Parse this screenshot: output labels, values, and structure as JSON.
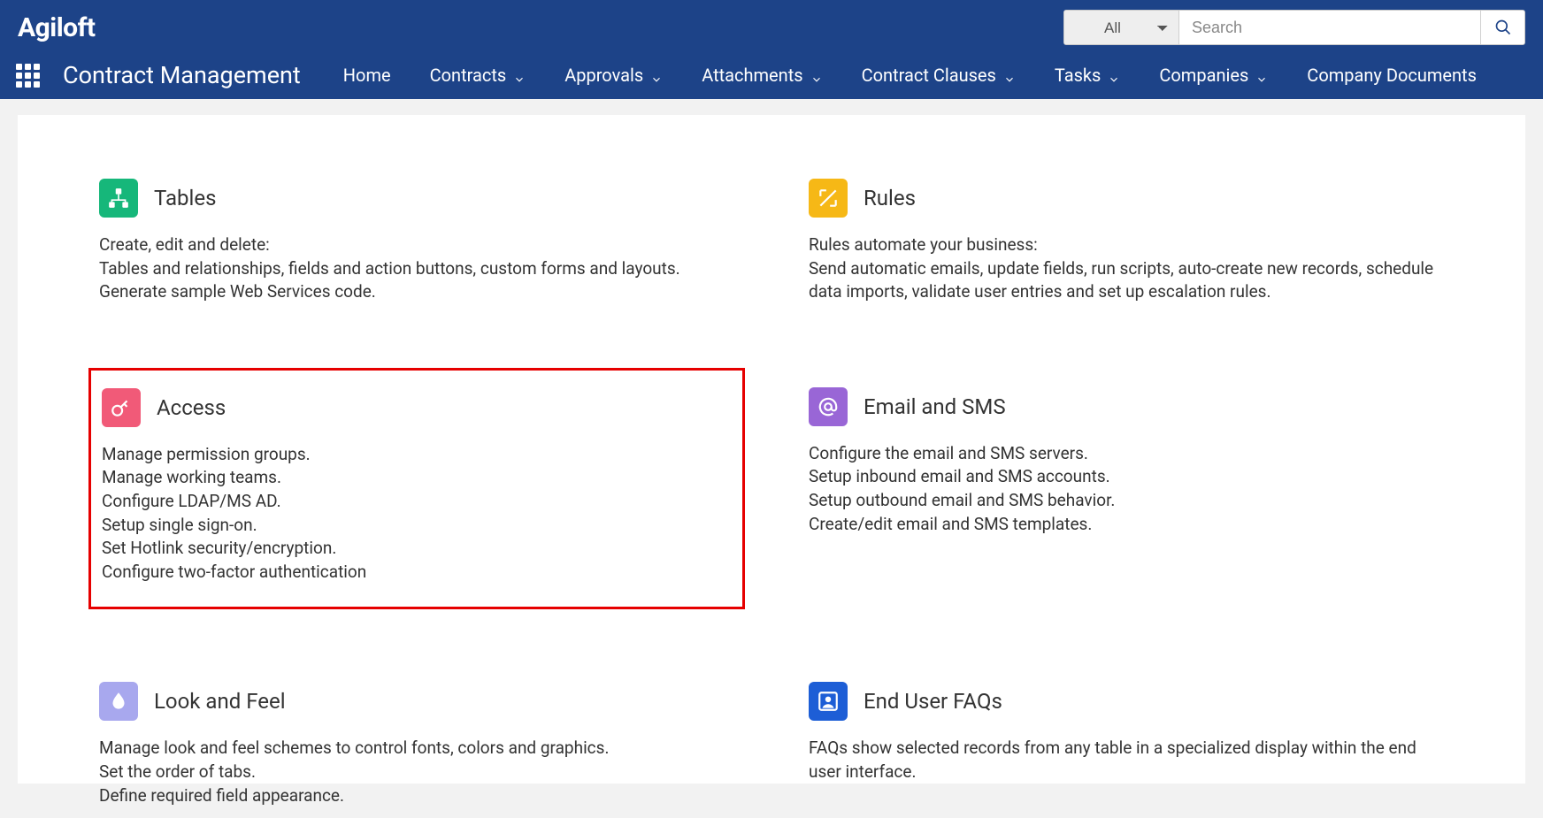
{
  "brand": "Agiloft",
  "search": {
    "filter": "All",
    "placeholder": "Search"
  },
  "app_title": "Contract Management",
  "nav": [
    {
      "label": "Home",
      "has_dropdown": false
    },
    {
      "label": "Contracts",
      "has_dropdown": true
    },
    {
      "label": "Approvals",
      "has_dropdown": true
    },
    {
      "label": "Attachments",
      "has_dropdown": true
    },
    {
      "label": "Contract Clauses",
      "has_dropdown": true
    },
    {
      "label": "Tasks",
      "has_dropdown": true
    },
    {
      "label": "Companies",
      "has_dropdown": true
    },
    {
      "label": "Company Documents",
      "has_dropdown": true
    }
  ],
  "tiles": {
    "tables": {
      "title": "Tables",
      "desc": "Create, edit and delete:\nTables and relationships, fields and action buttons, custom forms and layouts.\nGenerate sample Web Services code."
    },
    "rules": {
      "title": "Rules",
      "desc": "Rules automate your business:\nSend automatic emails, update fields, run scripts, auto-create new records, schedule data imports, validate user entries and set up escalation rules."
    },
    "access": {
      "title": "Access",
      "desc": "Manage permission groups.\nManage working teams.\nConfigure LDAP/MS AD.\nSetup single sign-on.\nSet Hotlink security/encryption.\nConfigure two-factor authentication"
    },
    "email": {
      "title": "Email and SMS",
      "desc": "Configure the email and SMS servers.\nSetup inbound email and SMS accounts.\nSetup outbound email and SMS behavior.\nCreate/edit email and SMS templates."
    },
    "look": {
      "title": "Look and Feel",
      "desc": "Manage look and feel schemes to control fonts, colors and graphics.\nSet the order of tabs.\nDefine required field appearance."
    },
    "faq": {
      "title": "End User FAQs",
      "desc": "FAQs show selected records from any table in a specialized display within the end user interface."
    }
  }
}
